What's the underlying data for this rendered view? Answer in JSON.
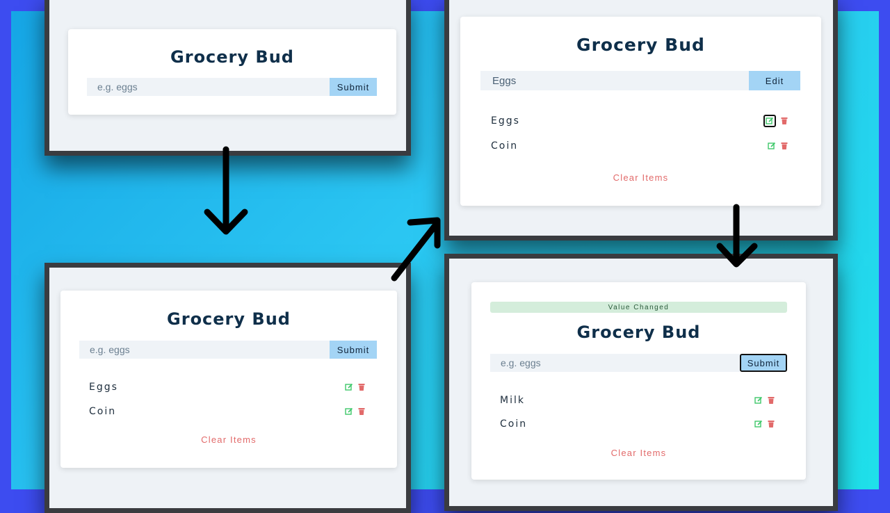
{
  "app": {
    "title": "Grocery Bud"
  },
  "form": {
    "placeholder": "e.g. eggs",
    "submit_label": "Submit",
    "edit_label": "Edit"
  },
  "clear_label": "Clear Items",
  "colors": {
    "accent": "#a3d4f5",
    "delete": "#e26a6a",
    "edit": "#3ec86a",
    "title": "#0f2f4a"
  },
  "panel1": {
    "input_value": ""
  },
  "panel2": {
    "input_value": "Eggs",
    "items": [
      "Eggs",
      "Coin"
    ]
  },
  "panel3": {
    "input_value": "",
    "items": [
      "Eggs",
      "Coin"
    ]
  },
  "panel4": {
    "alert": "Value Changed",
    "input_value": "",
    "items": [
      "Milk",
      "Coin"
    ]
  },
  "icons": {
    "edit": "edit-icon",
    "delete": "trash-icon",
    "arrow": "arrow-icon"
  }
}
